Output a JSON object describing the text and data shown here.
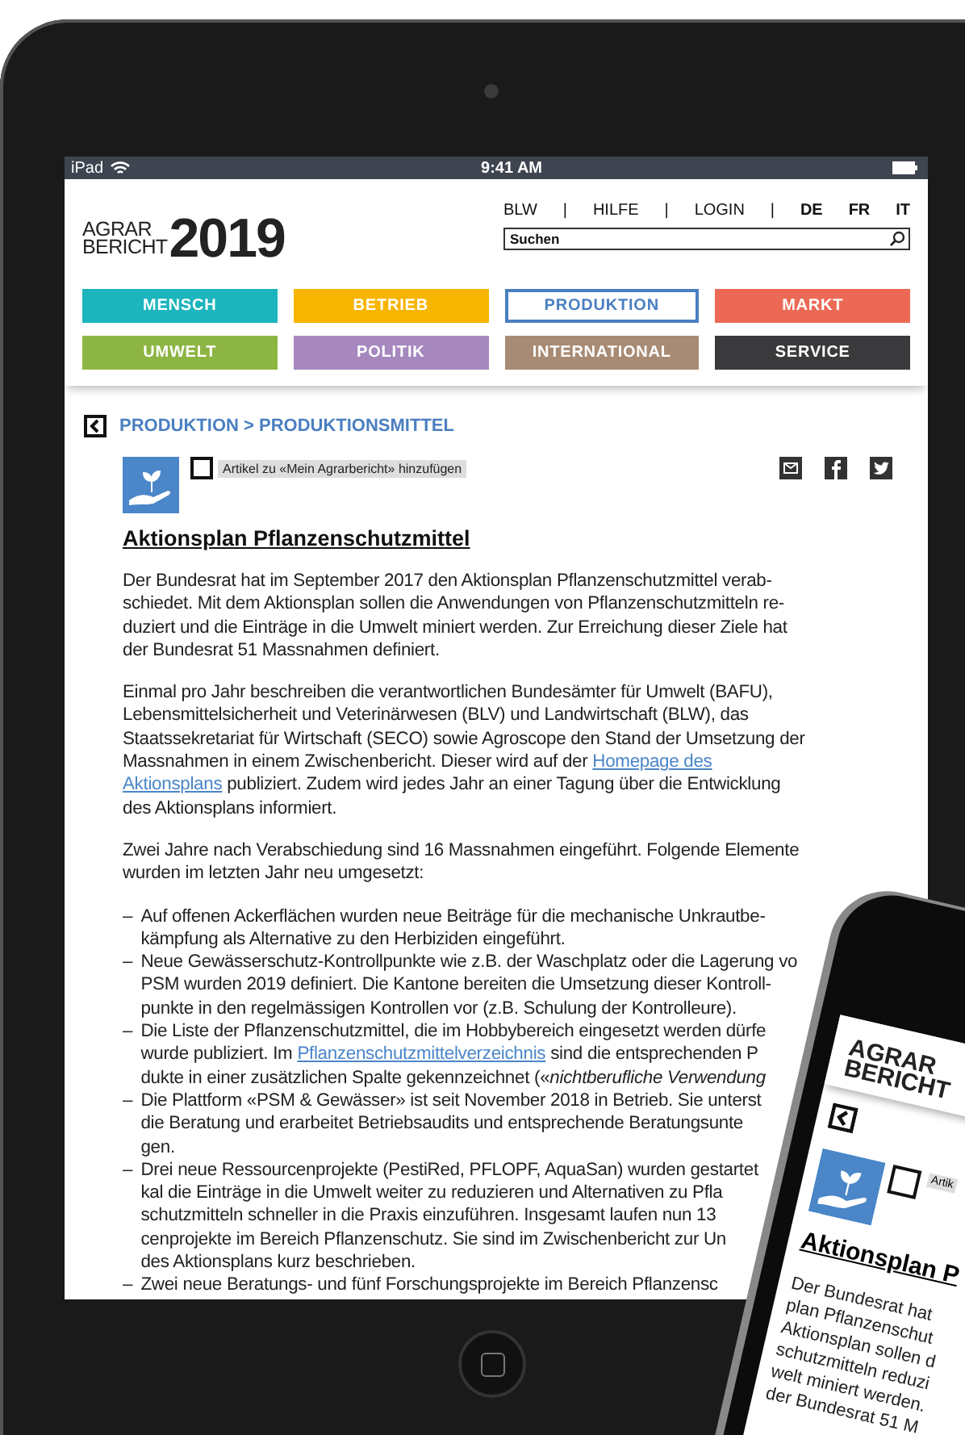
{
  "status_bar": {
    "device": "iPad",
    "time": "9:41 AM"
  },
  "header": {
    "logo": {
      "line_1": "AGRAR",
      "line_2": "BERICHT",
      "year": "2019"
    },
    "links": [
      "BLW",
      "HILFE",
      "LOGIN"
    ],
    "separator": "|",
    "languages": [
      "DE",
      "FR",
      "IT"
    ],
    "search": {
      "placeholder": "Suchen"
    }
  },
  "categories": [
    {
      "label": "MENSCH",
      "color": "#1cb5bd",
      "selected": false
    },
    {
      "label": "BETRIEB",
      "color": "#f7b500",
      "selected": false
    },
    {
      "label": "PRODUKTION",
      "color": "#4a7fc1",
      "selected": true
    },
    {
      "label": "MARKT",
      "color": "#ec6a55",
      "selected": false
    },
    {
      "label": "UMWELT",
      "color": "#8db543",
      "selected": false
    },
    {
      "label": "POLITIK",
      "color": "#a688bf",
      "selected": false
    },
    {
      "label": "INTERNATIONAL",
      "color": "#a88b74",
      "selected": false
    },
    {
      "label": "SERVICE",
      "color": "#3a3a3c",
      "selected": false
    }
  ],
  "breadcrumb": "PRODUKTION > PRODUKTIONSMITTEL",
  "bookmark": {
    "label": "Artikel zu «Mein Agrarbericht» hinzufügen",
    "checked": false
  },
  "article": {
    "title": "Aktionsplan Pflanzenschutzmittel",
    "blocks": [
      {
        "kind": "paragraph",
        "lines": [
          "Der Bundesrat hat im September 2017 den Aktionsplan Pflanzenschutzmittel verab-",
          "schiedet. Mit dem Aktionsplan sollen die Anwendungen von Pflanzenschutzmitteln re-",
          "duziert und die Einträge in die Umwelt miniert werden. Zur Erreichung dieser Ziele hat",
          "der Bundesrat 51 Massnahmen definiert."
        ]
      },
      {
        "kind": "paragraph",
        "lines": [
          "Einmal pro Jahr beschreiben die verantwortlichen Bundesämter für Umwelt (BAFU),",
          "Lebensmittelsicherheit und Veterinärwesen (BLV) und Landwirtschaft (BLW), das",
          "Staatssekretariat für Wirtschaft (SECO) sowie Agroscope den Stand der Umsetzung der",
          [
            {
              "text": "Massnahmen in einem Zwischenbericht. Dieser wird auf der ",
              "link": false
            },
            {
              "text": "Homepage des",
              "link": true
            }
          ],
          [
            {
              "text": "Aktionsplans",
              "link": true
            },
            {
              "text": " publiziert. Zudem wird jedes Jahr an einer Tagung über die Entwicklung",
              "link": false
            }
          ],
          "des Aktionsplans informiert."
        ]
      },
      {
        "kind": "paragraph",
        "lines": [
          "Zwei Jahre nach Verabschiedung sind 16 Massnahmen eingeführt. Folgende Elemente",
          "wurden im letzten Jahr neu umgesetzt:"
        ]
      },
      {
        "kind": "list",
        "bullet": "–",
        "items": [
          {
            "lines": [
              "Auf offenen Ackerflächen wurden neue Beiträge für die mechanische Unkrautbe-",
              "kämpfung als Alternative zu den Herbiziden eingeführt."
            ]
          },
          {
            "lines": [
              "Neue Gewässerschutz-Kontrollpunkte wie z.B. der Waschplatz oder die Lagerung vo",
              "PSM wurden 2019 definiert. Die Kantone bereiten die Umsetzung dieser Kontroll-",
              "punkte in den regelmässigen Kontrollen vor (z.B. Schulung der Kontrolleure)."
            ]
          },
          {
            "lines": [
              "Die Liste der Pflanzenschutzmittel, die im Hobbybereich eingesetzt werden dürfe",
              [
                {
                  "text": "wurde publiziert. Im ",
                  "link": false
                },
                {
                  "text": "Pflanzenschutzmittelverzeichnis",
                  "link": true
                },
                {
                  "text": " sind die entsprechenden P",
                  "link": false
                }
              ],
              "dukte in einer zusätzlichen Spalte gekennzeichnet («*nichtberufliche Verwendung*"
            ]
          },
          {
            "lines": [
              "Die Plattform «PSM & Gewässer» ist seit November 2018 in Betrieb. Sie unterst",
              "die Beratung und erarbeitet Betriebsaudits und entsprechende Beratungsunte",
              "gen."
            ]
          },
          {
            "lines": [
              "Drei neue Ressourcenprojekte (PestiRed, PFLOPF, AquaSan) wurden gestartet",
              "kal die Einträge in die Umwelt weiter zu reduzieren und Alternativen zu Pfla",
              "schutzmitteln schneller in die Praxis einzuführen. Insgesamt laufen nun 13",
              "cenprojekte im Bereich Pflanzenschutz. Sie sind im Zwischenbericht zur Un",
              "des Aktionsplans kurz beschrieben."
            ]
          },
          {
            "lines": [
              "Zwei neue Beratungs- und fünf Forschungsprojekte im Bereich Pflanzensc"
            ]
          }
        ]
      }
    ]
  },
  "phone": {
    "logo": {
      "line_1": "AGRAR",
      "line_2": "BERICHT"
    },
    "bookmark": "Artik",
    "checked": false,
    "title": "Aktionsplan P",
    "lines": [
      "Der Bundesrat hat",
      "plan Pflanzenschut",
      "Aktionsplan sollen d",
      "schutzmitteln reduzi",
      "welt miniert werden.",
      "der Bundesrat 51 M"
    ]
  }
}
